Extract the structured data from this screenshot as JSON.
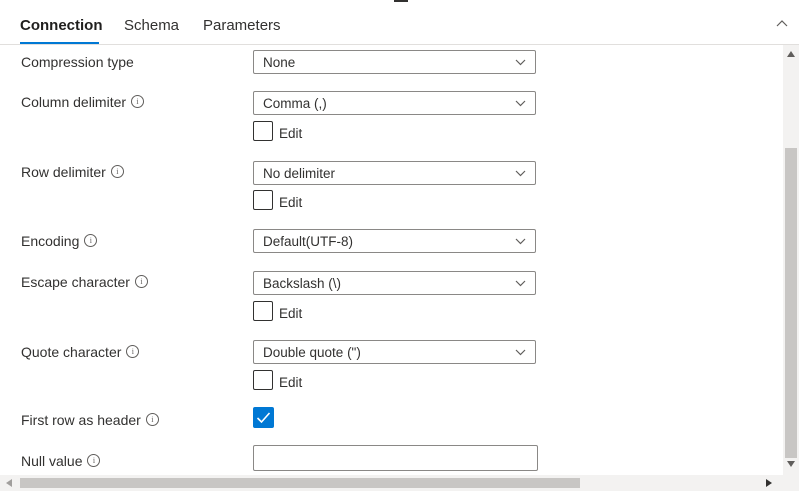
{
  "tabs": [
    {
      "label": "Connection",
      "active": true
    },
    {
      "label": "Schema",
      "active": false
    },
    {
      "label": "Parameters",
      "active": false
    }
  ],
  "fields": {
    "compression_type": {
      "label": "Compression type",
      "value": "None"
    },
    "column_delimiter": {
      "label": "Column delimiter",
      "value": "Comma (,)",
      "edit_label": "Edit",
      "edit_checked": false
    },
    "row_delimiter": {
      "label": "Row delimiter",
      "value": "No delimiter",
      "edit_label": "Edit",
      "edit_checked": false
    },
    "encoding": {
      "label": "Encoding",
      "value": "Default(UTF-8)"
    },
    "escape_character": {
      "label": "Escape character",
      "value": "Backslash (\\)",
      "edit_label": "Edit",
      "edit_checked": false
    },
    "quote_character": {
      "label": "Quote character",
      "value": "Double quote (\")",
      "edit_label": "Edit",
      "edit_checked": false
    },
    "first_row_as_header": {
      "label": "First row as header",
      "checked": true
    },
    "null_value": {
      "label": "Null value",
      "value": ""
    }
  },
  "info_glyph": "i",
  "icons": {
    "collapse": "chevron-up-icon",
    "dropdown": "chevron-down-icon",
    "info": "info-icon",
    "check": "checkmark-icon"
  },
  "colors": {
    "accent": "#0078d4",
    "text": "#323130",
    "border": "#8a8886"
  }
}
